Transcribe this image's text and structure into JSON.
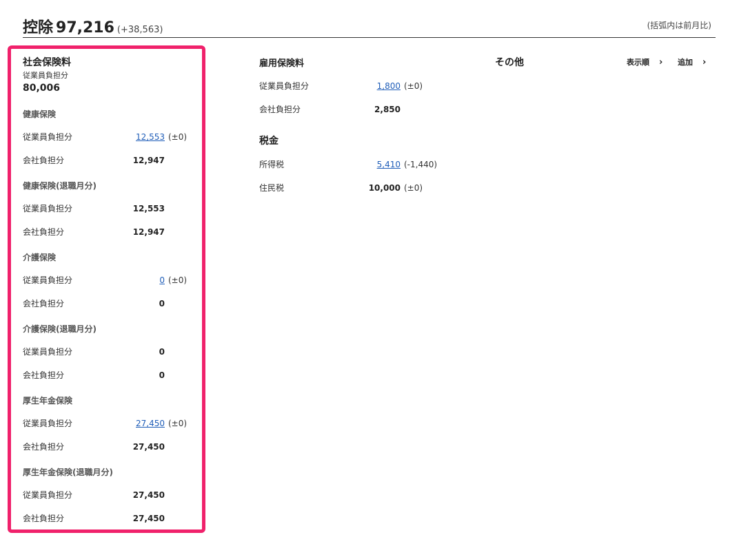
{
  "header": {
    "title": "控除",
    "amount": "97,216",
    "diff": "(+38,563)",
    "note": "(括弧内は前月比)"
  },
  "social_insurance": {
    "title": "社会保険料",
    "employee_label": "従業員負担分",
    "employee_total": "80,006",
    "groups": [
      {
        "title": "健康保険",
        "rows": [
          {
            "label": "従業員負担分",
            "value": "12,553",
            "link": true,
            "diff": "(±0)"
          },
          {
            "label": "会社負担分",
            "value": "12,947",
            "link": false,
            "diff": ""
          }
        ]
      },
      {
        "title": "健康保険(退職月分)",
        "rows": [
          {
            "label": "従業員負担分",
            "value": "12,553",
            "link": false,
            "diff": ""
          },
          {
            "label": "会社負担分",
            "value": "12,947",
            "link": false,
            "diff": ""
          }
        ]
      },
      {
        "title": "介護保険",
        "rows": [
          {
            "label": "従業員負担分",
            "value": "0",
            "link": true,
            "diff": "(±0)"
          },
          {
            "label": "会社負担分",
            "value": "0",
            "link": false,
            "diff": ""
          }
        ]
      },
      {
        "title": "介護保険(退職月分)",
        "rows": [
          {
            "label": "従業員負担分",
            "value": "0",
            "link": false,
            "diff": ""
          },
          {
            "label": "会社負担分",
            "value": "0",
            "link": false,
            "diff": ""
          }
        ]
      },
      {
        "title": "厚生年金保険",
        "rows": [
          {
            "label": "従業員負担分",
            "value": "27,450",
            "link": true,
            "diff": "(±0)"
          },
          {
            "label": "会社負担分",
            "value": "27,450",
            "link": false,
            "diff": ""
          }
        ]
      },
      {
        "title": "厚生年金保険(退職月分)",
        "rows": [
          {
            "label": "従業員負担分",
            "value": "27,450",
            "link": false,
            "diff": ""
          },
          {
            "label": "会社負担分",
            "value": "27,450",
            "link": false,
            "diff": ""
          }
        ]
      }
    ]
  },
  "employment_insurance": {
    "title": "雇用保険料",
    "rows": [
      {
        "label": "従業員負担分",
        "value": "1,800",
        "link": true,
        "diff": "(±0)"
      },
      {
        "label": "会社負担分",
        "value": "2,850",
        "link": false,
        "diff": ""
      }
    ]
  },
  "tax": {
    "title": "税金",
    "rows": [
      {
        "label": "所得税",
        "value": "5,410",
        "link": true,
        "diff": "(-1,440)"
      },
      {
        "label": "住民税",
        "value": "10,000",
        "link": false,
        "diff": "(±0)"
      }
    ]
  },
  "other": {
    "title": "その他",
    "sort_label": "表示順",
    "add_label": "追加",
    "chevron": "›"
  },
  "colors": {
    "highlight": "#f0216b",
    "link": "#1f5db8"
  }
}
